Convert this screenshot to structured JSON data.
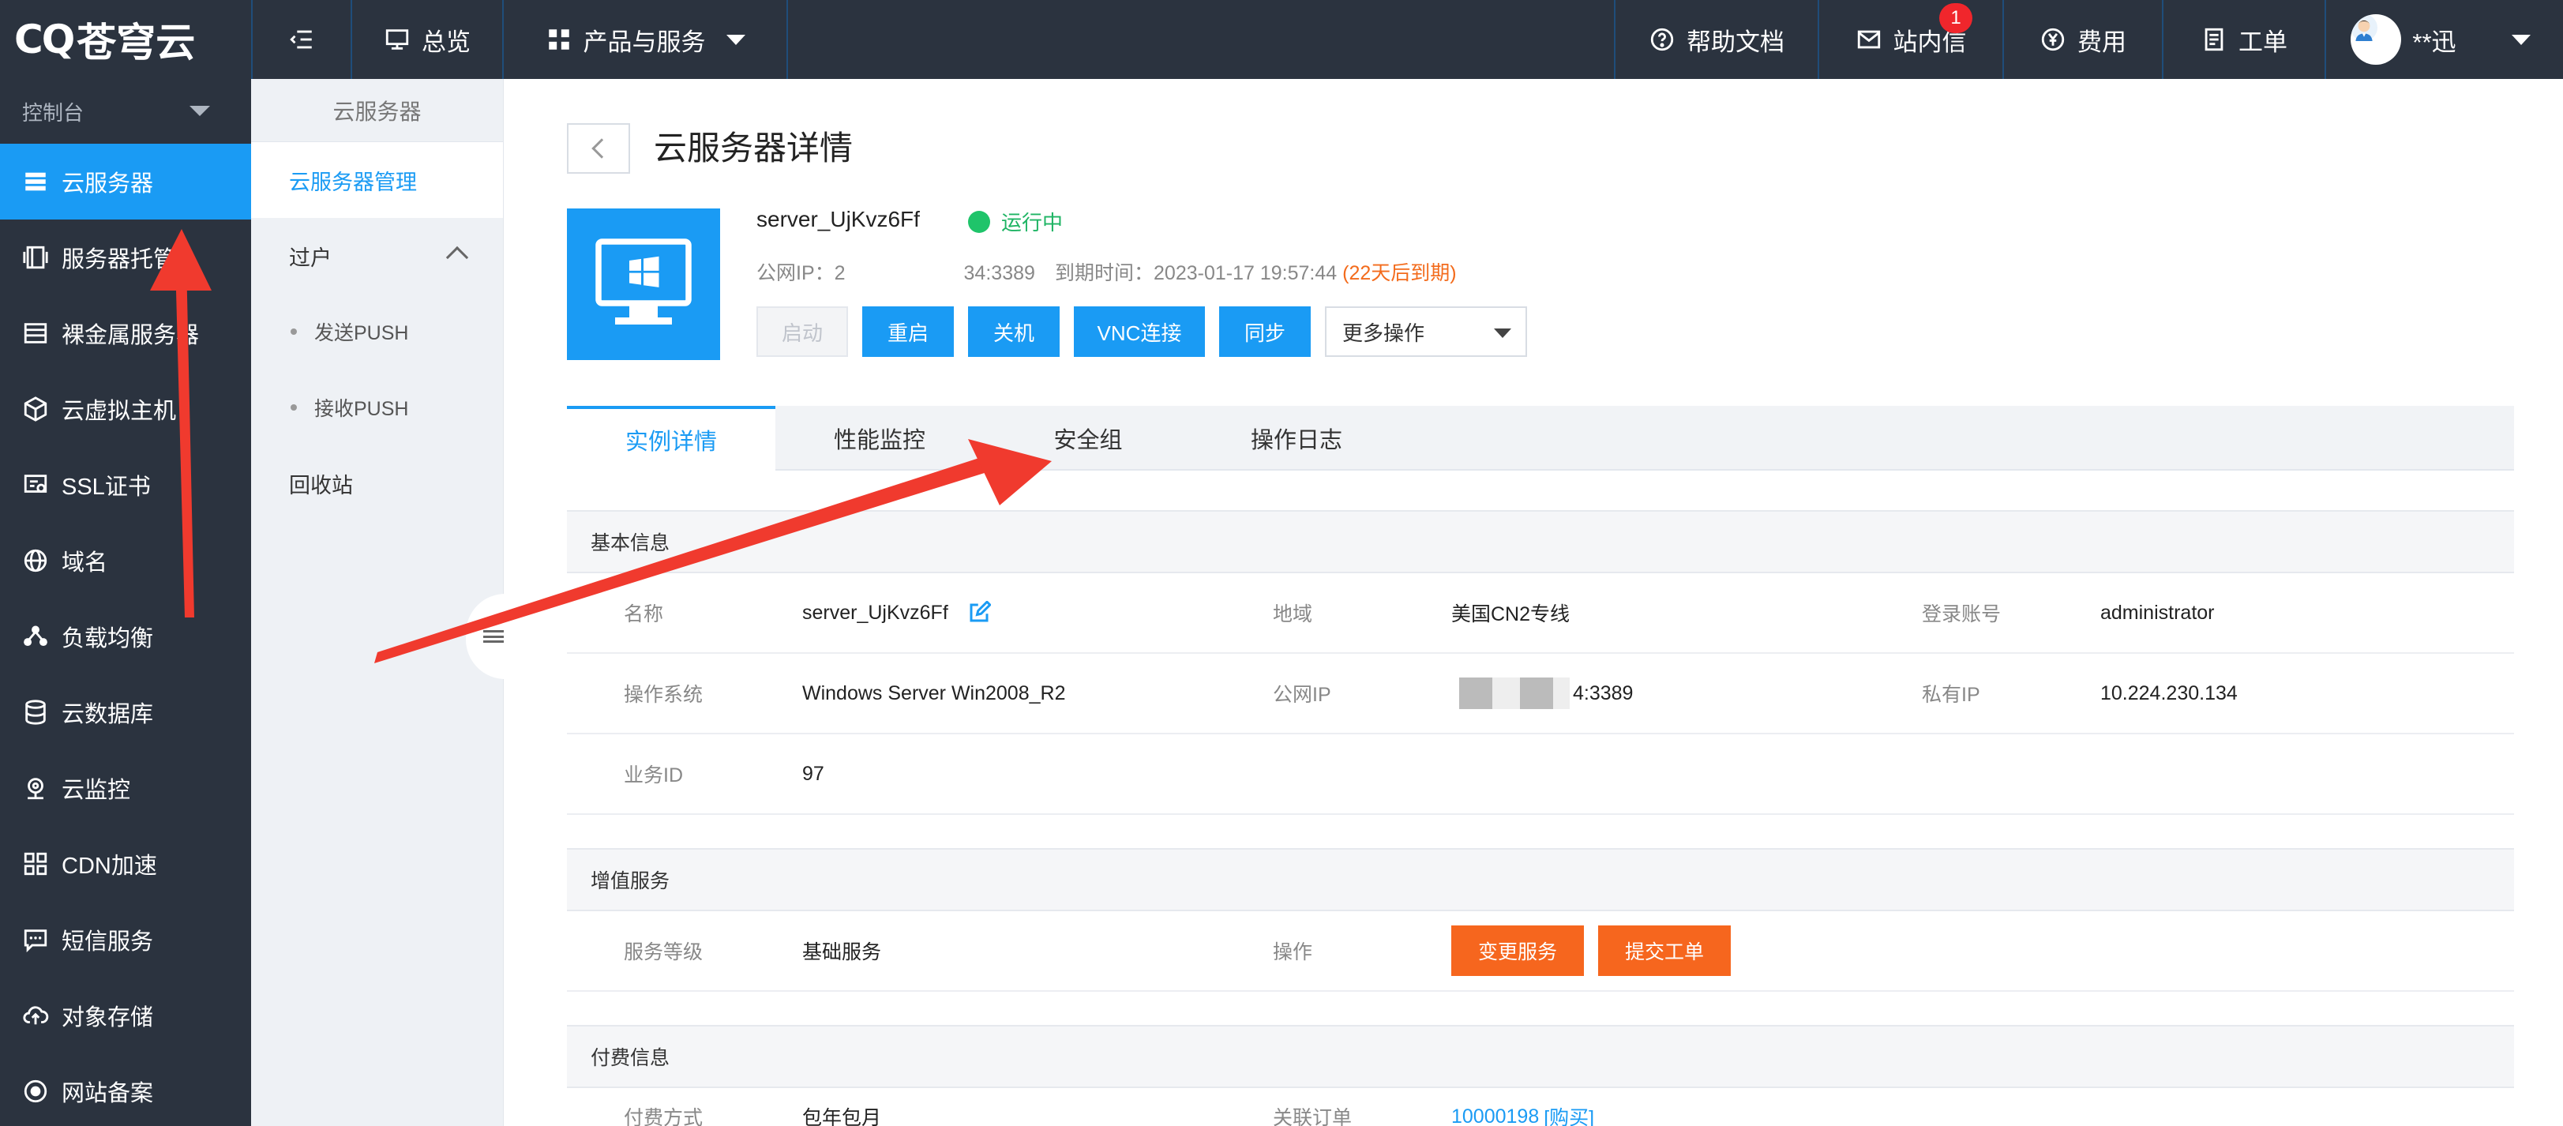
{
  "brand": {
    "mark": "CQ",
    "name": "苍穹云"
  },
  "topbar": {
    "overview": "总览",
    "products": "产品与服务",
    "help": "帮助文档",
    "messages": "站内信",
    "messages_badge": "1",
    "billing": "费用",
    "tickets": "工单",
    "user": "**迅"
  },
  "sidebar": {
    "console": "控制台",
    "items": [
      {
        "label": "云服务器",
        "icon": "server-icon"
      },
      {
        "label": "服务器托管",
        "icon": "hosting-icon"
      },
      {
        "label": "裸金属服务器",
        "icon": "baremetal-icon"
      },
      {
        "label": "云虚拟主机",
        "icon": "cube-icon"
      },
      {
        "label": "SSL证书",
        "icon": "certificate-icon"
      },
      {
        "label": "域名",
        "icon": "globe-icon"
      },
      {
        "label": "负载均衡",
        "icon": "balance-icon"
      },
      {
        "label": "云数据库",
        "icon": "database-icon"
      },
      {
        "label": "云监控",
        "icon": "monitor-icon"
      },
      {
        "label": "CDN加速",
        "icon": "cdn-icon"
      },
      {
        "label": "短信服务",
        "icon": "sms-icon"
      },
      {
        "label": "对象存储",
        "icon": "cloud-upload-icon"
      },
      {
        "label": "网站备案",
        "icon": "record-icon"
      }
    ]
  },
  "subnav": {
    "title": "云服务器",
    "manage": "云服务器管理",
    "transfer": "过户",
    "send_push": "发送PUSH",
    "recv_push": "接收PUSH",
    "recycle": "回收站"
  },
  "page": {
    "title": "云服务器详情",
    "server_name": "server_UjKvz6Ff",
    "status": "运行中",
    "public_ip_label": "公网IP：",
    "public_ip_head": "2",
    "public_ip_tail": "34:3389",
    "expire_label": "到期时间：",
    "expire_value": "2023-01-17 19:57:44",
    "expire_warn": "(22天后到期)",
    "actions": {
      "start": "启动",
      "restart": "重启",
      "shutdown": "关机",
      "vnc": "VNC连接",
      "sync": "同步",
      "more": "更多操作"
    }
  },
  "tabs": [
    "实例详情",
    "性能监控",
    "安全组",
    "操作日志"
  ],
  "basic": {
    "header": "基本信息",
    "name_label": "名称",
    "name_value": "server_UjKvz6Ff",
    "region_label": "地域",
    "region_value": "美国CN2专线",
    "login_label": "登录账号",
    "login_value": "administrator",
    "os_label": "操作系统",
    "os_value": "Windows Server Win2008_R2",
    "pubip_label": "公网IP",
    "pubip_value": "4:3389",
    "privip_label": "私有IP",
    "privip_value": "10.224.230.134",
    "bizid_label": "业务ID",
    "bizid_value": "97"
  },
  "value_added": {
    "header": "增值服务",
    "level_label": "服务等级",
    "level_value": "基础服务",
    "op_label": "操作",
    "change_btn": "变更服务",
    "ticket_btn": "提交工单"
  },
  "payment": {
    "header": "付费信息",
    "method_label": "付费方式",
    "method_value": "包年包月",
    "order_label": "关联订单",
    "order_value": "10000198",
    "order_extra": "[购买]"
  },
  "colors": {
    "accent": "#1a9bf4",
    "dark": "#2b333f",
    "orange": "#f6661e",
    "arrow": "#f03a2e"
  }
}
